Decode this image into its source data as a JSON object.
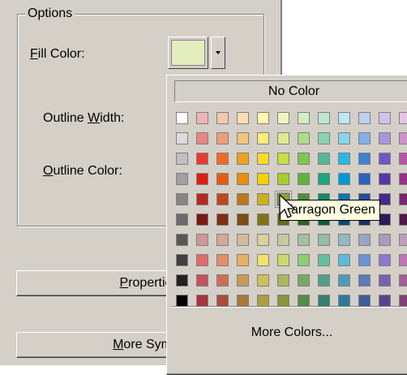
{
  "options": {
    "group_label": "Options",
    "fill_color": {
      "label_first": "F",
      "label_rest": "ill Color:",
      "value": "#e3edbe"
    },
    "outline_width": {
      "label_pre": "Outline ",
      "label_ul": "W",
      "label_post": "idth:"
    },
    "outline_color": {
      "label_first": "O",
      "label_rest": "utline Color:"
    }
  },
  "buttons": {
    "properties": {
      "ul": "P",
      "rest": "ropertie"
    },
    "more_symbols": {
      "ul": "M",
      "rest": "ore Symb"
    }
  },
  "palette": {
    "no_color_label": "No Color",
    "more_colors_label": "More Colors...",
    "tooltip": "Tarragon Green",
    "hover_color_name": "Tarragon Green",
    "rows": [
      [
        "#ffffff",
        "#f0b4b4",
        "#f4c7b0",
        "#f8e0b0",
        "#fff6b0",
        "#eff4bf",
        "#d3ecc0",
        "#c0e6d4",
        "#bfe6f2",
        "#bcd2f0",
        "#cfc4ec",
        "#e6c4e4"
      ],
      [
        "#dcdcdc",
        "#e98585",
        "#ef9d7b",
        "#f3c47c",
        "#fdec7a",
        "#ddea8e",
        "#aedb8e",
        "#8ad3b5",
        "#89d3eb",
        "#86aee6",
        "#a896dd",
        "#cd92c8"
      ],
      [
        "#c0c0c0",
        "#ea3a2e",
        "#f36a24",
        "#f3a020",
        "#f9dc25",
        "#c5df44",
        "#7fc552",
        "#52b896",
        "#27b8e6",
        "#3d81d2",
        "#7156c5",
        "#b456a8"
      ],
      [
        "#a0a0a0",
        "#e01e10",
        "#e85b10",
        "#e8900a",
        "#f1d200",
        "#a7cc2c",
        "#63b23c",
        "#1aa67e",
        "#0098d6",
        "#2a63bd",
        "#5937a8",
        "#96308c"
      ],
      [
        "#868686",
        "#b42a1e",
        "#c0461e",
        "#bd7818",
        "#c9b21c",
        "#8aa62a",
        "#4d9032",
        "#0f8a69",
        "#0076b0",
        "#1f4e9c",
        "#45298a",
        "#7a2572"
      ],
      [
        "#6b6b6b",
        "#7a1a12",
        "#7e2e14",
        "#7c4e12",
        "#827218",
        "#5b6e1e",
        "#346220",
        "#0b5c46",
        "#004e74",
        "#163566",
        "#2c1c5a",
        "#50184a"
      ],
      [
        "#575757",
        "#d2959a",
        "#d3a79a",
        "#d3bc9b",
        "#d9d09e",
        "#c0cc9e",
        "#a3c19e",
        "#95bba9",
        "#96b8c4",
        "#97a6c3",
        "#a69dbf",
        "#bd9eb8"
      ],
      [
        "#404040",
        "#e46a6a",
        "#e98a6a",
        "#e9b060",
        "#f3e36a",
        "#c8dc6a",
        "#8ccd76",
        "#65c0a0",
        "#5ebadc",
        "#6a95d6",
        "#8f78cc",
        "#bf74b4"
      ],
      [
        "#222222",
        "#c9525a",
        "#cc6e58",
        "#c99a55",
        "#cfc05c",
        "#a8b85b",
        "#76aa62",
        "#53a08a",
        "#4e9cbc",
        "#5a7cb8",
        "#7762ad",
        "#a05f96"
      ],
      [
        "#000000",
        "#a8343e",
        "#aa4b3c",
        "#a67a36",
        "#ad9e3e",
        "#87963c",
        "#578a46",
        "#357e6c",
        "#2f7a9c",
        "#3e5c98",
        "#58448e",
        "#7f4176"
      ]
    ]
  }
}
